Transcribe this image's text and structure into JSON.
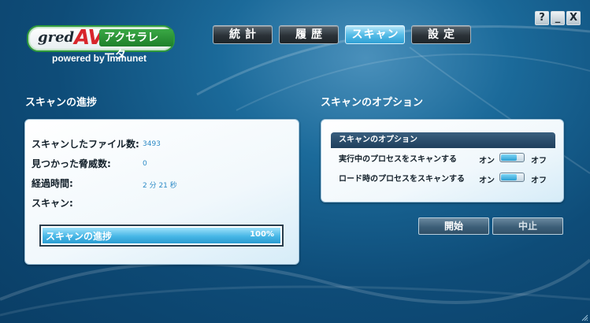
{
  "brand": {
    "logo_gred": "gred",
    "logo_av": "AV",
    "logo_accel": "アクセラレータ",
    "powered_by": "powered by Immunet"
  },
  "tabs": [
    {
      "label": "統計",
      "active": false
    },
    {
      "label": "履歴",
      "active": false
    },
    {
      "label": "スキャン",
      "active": true
    },
    {
      "label": "設定",
      "active": false
    }
  ],
  "window_controls": {
    "help": "?",
    "minimize": "_",
    "close": "X"
  },
  "scan_progress": {
    "title": "スキャンの進捗",
    "files_scanned_label": "スキャンしたファイル数:",
    "files_scanned_value": "3493",
    "threats_found_label": "見つかった脅威数:",
    "threats_found_value": "0",
    "elapsed_label": "経過時間:",
    "elapsed_value": "2 分 21 秒",
    "scan_label": "スキャン:",
    "bar_label": "スキャンの進捗",
    "bar_percent_text": "100%",
    "bar_fraction": 1.0
  },
  "scan_options": {
    "title": "スキャンのオプション",
    "box_header": "スキャンのオプション",
    "rows": [
      {
        "label": "実行中のプロセスをスキャンする",
        "on_label": "オン",
        "off_label": "オフ",
        "state": "on"
      },
      {
        "label": "ロード時のプロセスをスキャンする",
        "on_label": "オン",
        "off_label": "オフ",
        "state": "on"
      }
    ]
  },
  "actions": {
    "start": "開始",
    "stop": "中止"
  },
  "colors": {
    "accent": "#2d8bc6",
    "active_tab": "#57bde8",
    "logo_red": "#d8262b",
    "logo_green": "#2f9a3a"
  }
}
